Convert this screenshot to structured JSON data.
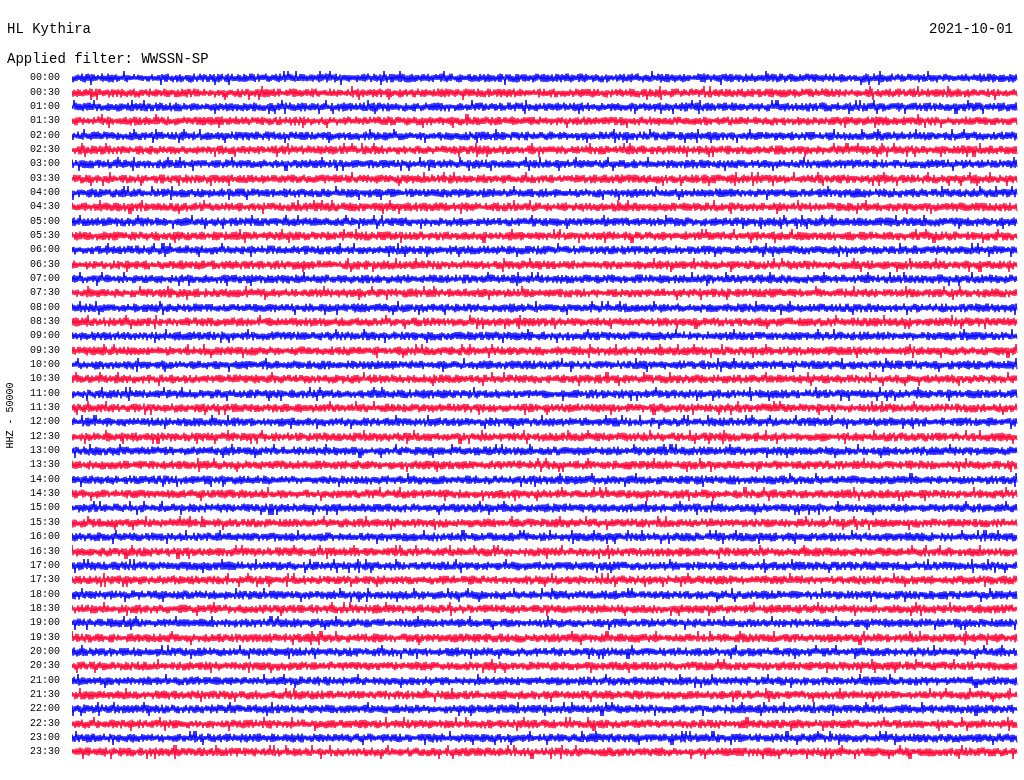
{
  "header": {
    "station": "HL Kythira",
    "date": "2021-10-01",
    "filter": "Applied filter: WWSSN-SP"
  },
  "axis_label": "HHZ - 50000",
  "rows": [
    {
      "time": "00:00",
      "color": "#0000ff"
    },
    {
      "time": "00:30",
      "color": "#ff0033"
    },
    {
      "time": "01:00",
      "color": "#0000ff"
    },
    {
      "time": "01:30",
      "color": "#ff0033"
    },
    {
      "time": "02:00",
      "color": "#0000ff"
    },
    {
      "time": "02:30",
      "color": "#ff0033"
    },
    {
      "time": "03:00",
      "color": "#0000ff"
    },
    {
      "time": "03:30",
      "color": "#ff0033"
    },
    {
      "time": "04:00",
      "color": "#0000ff"
    },
    {
      "time": "04:30",
      "color": "#ff0033"
    },
    {
      "time": "05:00",
      "color": "#0000ff"
    },
    {
      "time": "05:30",
      "color": "#ff0033"
    },
    {
      "time": "06:00",
      "color": "#0000ff"
    },
    {
      "time": "06:30",
      "color": "#ff0033"
    },
    {
      "time": "07:00",
      "color": "#0000ff"
    },
    {
      "time": "07:30",
      "color": "#ff0033"
    },
    {
      "time": "08:00",
      "color": "#0000ff"
    },
    {
      "time": "08:30",
      "color": "#ff0033"
    },
    {
      "time": "09:00",
      "color": "#0000ff"
    },
    {
      "time": "09:30",
      "color": "#ff0033"
    },
    {
      "time": "10:00",
      "color": "#0000ff"
    },
    {
      "time": "10:30",
      "color": "#ff0033"
    },
    {
      "time": "11:00",
      "color": "#0000ff"
    },
    {
      "time": "11:30",
      "color": "#ff0033"
    },
    {
      "time": "12:00",
      "color": "#0000ff"
    },
    {
      "time": "12:30",
      "color": "#ff0033"
    },
    {
      "time": "13:00",
      "color": "#0000ff"
    },
    {
      "time": "13:30",
      "color": "#ff0033"
    },
    {
      "time": "14:00",
      "color": "#0000ff"
    },
    {
      "time": "14:30",
      "color": "#ff0033"
    },
    {
      "time": "15:00",
      "color": "#0000ff"
    },
    {
      "time": "15:30",
      "color": "#ff0033"
    },
    {
      "time": "16:00",
      "color": "#0000ff"
    },
    {
      "time": "16:30",
      "color": "#ff0033"
    },
    {
      "time": "17:00",
      "color": "#0000ff"
    },
    {
      "time": "17:30",
      "color": "#ff0033"
    },
    {
      "time": "18:00",
      "color": "#0000ff"
    },
    {
      "time": "18:30",
      "color": "#ff0033"
    },
    {
      "time": "19:00",
      "color": "#0000ff"
    },
    {
      "time": "19:30",
      "color": "#ff0033"
    },
    {
      "time": "20:00",
      "color": "#0000ff"
    },
    {
      "time": "20:30",
      "color": "#ff0033"
    },
    {
      "time": "21:00",
      "color": "#0000ff"
    },
    {
      "time": "21:30",
      "color": "#ff0033"
    },
    {
      "time": "22:00",
      "color": "#0000ff"
    },
    {
      "time": "22:30",
      "color": "#ff0033"
    },
    {
      "time": "23:00",
      "color": "#0000ff"
    },
    {
      "time": "23:30",
      "color": "#ff0033"
    }
  ]
}
